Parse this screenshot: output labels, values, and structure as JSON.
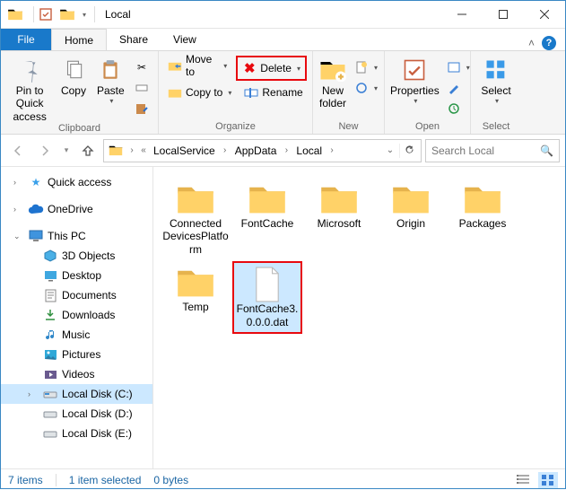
{
  "window": {
    "title": "Local"
  },
  "tabs": {
    "file": "File",
    "home": "Home",
    "share": "Share",
    "view": "View"
  },
  "ribbon": {
    "clipboard": {
      "label": "Clipboard",
      "pin": "Pin to Quick\naccess",
      "copy": "Copy",
      "paste": "Paste"
    },
    "organize": {
      "label": "Organize",
      "moveto": "Move to",
      "copyto": "Copy to",
      "delete": "Delete",
      "rename": "Rename"
    },
    "new": {
      "label": "New",
      "newfolder": "New\nfolder"
    },
    "open": {
      "label": "Open",
      "properties": "Properties"
    },
    "select": {
      "label": "Select",
      "select": "Select"
    }
  },
  "breadcrumb": {
    "seg1": "LocalService",
    "seg2": "AppData",
    "seg3": "Local"
  },
  "search": {
    "placeholder": "Search Local"
  },
  "sidebar": {
    "quickaccess": "Quick access",
    "onedrive": "OneDrive",
    "thispc": "This PC",
    "objects3d": "3D Objects",
    "desktop": "Desktop",
    "documents": "Documents",
    "downloads": "Downloads",
    "music": "Music",
    "pictures": "Pictures",
    "videos": "Videos",
    "diskc": "Local Disk (C:)",
    "diskd": "Local Disk (D:)",
    "diske": "Local Disk (E:)"
  },
  "items": [
    {
      "type": "folder",
      "label": "Connected\nDevicesPlatform"
    },
    {
      "type": "folder",
      "label": "FontCache"
    },
    {
      "type": "folder",
      "label": "Microsoft"
    },
    {
      "type": "folder",
      "label": "Origin"
    },
    {
      "type": "folder",
      "label": "Packages"
    },
    {
      "type": "folder",
      "label": "Temp"
    },
    {
      "type": "file",
      "label": "FontCache3.0.0.0.dat",
      "selected": true
    }
  ],
  "status": {
    "count": "7 items",
    "selected": "1 item selected",
    "size": "0 bytes"
  }
}
